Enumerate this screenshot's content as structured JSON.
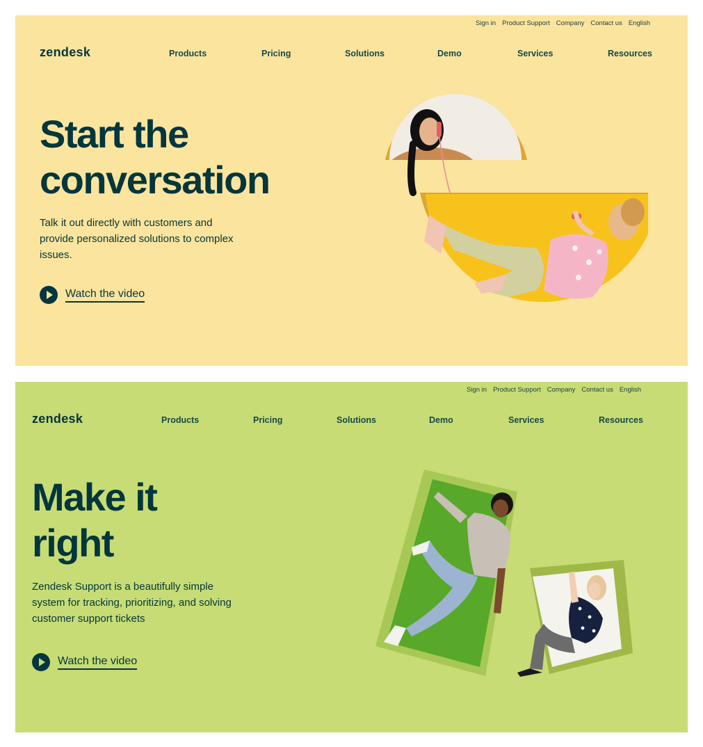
{
  "panels": [
    {
      "utility_links": [
        "Sign in",
        "Product Support",
        "Company",
        "Contact us",
        "English"
      ],
      "logo": "zendesk",
      "nav": [
        "Products",
        "Pricing",
        "Solutions",
        "Demo",
        "Services",
        "Resources"
      ],
      "headline_lines": [
        "Start the",
        "conversation"
      ],
      "subtext": "Talk it out directly with customers and provide personalized solutions to complex issues.",
      "cta": "Watch the video",
      "background": "#fbe49d"
    },
    {
      "utility_links": [
        "Sign in",
        "Product Support",
        "Company",
        "Contact us",
        "English"
      ],
      "logo": "zendesk",
      "nav": [
        "Products",
        "Pricing",
        "Solutions",
        "Demo",
        "Services",
        "Resources"
      ],
      "headline_lines": [
        "Make it",
        "right"
      ],
      "subtext": "Zendesk Support is a beautifully simple system for tracking, prioritizing, and solving customer support tickets",
      "cta": "Watch the video",
      "background": "#c7dc74"
    }
  ],
  "icons": {
    "cta": "play-icon"
  },
  "colors": {
    "primary_text": "#03363d",
    "yellow_bg": "#fbe49d",
    "green_bg": "#c7dc74"
  }
}
